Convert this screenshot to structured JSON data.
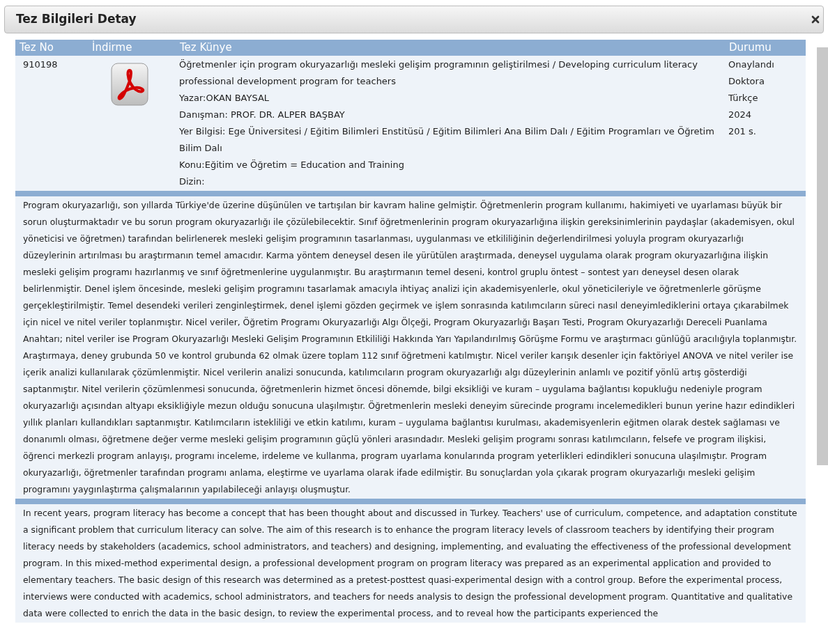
{
  "dialog": {
    "title": "Tez Bilgileri Detay"
  },
  "table": {
    "columns": [
      "Tez No",
      "İndirme",
      "Tez Künye",
      "Durumu"
    ],
    "thesis_no": "910198",
    "kunye": [
      "Öğretmenler için program okuryazarlığı mesleki gelişim programının geliştirilmesi / Developing curriculum literacy professional development program for teachers",
      "Yazar:OKAN BAYSAL",
      "Danışman: PROF. DR. ALPER BAŞBAY",
      "Yer Bilgisi: Ege Üniversitesi / Eğitim Bilimleri Enstitüsü / Eğitim Bilimleri Ana Bilim Dalı / Eğitim Programları ve Öğretim Bilim Dalı",
      "Konu:Eğitim ve Öğretim = Education and Training",
      "Dizin:"
    ],
    "durumu": [
      "Onaylandı",
      "Doktora",
      "Türkçe",
      "2024",
      "201 s."
    ]
  },
  "abstracts": [
    "Program okuryazarlığı, son yıllarda Türkiye'de üzerine düşünülen ve tartışılan bir kavram haline gelmiştir. Öğretmenlerin program kullanımı, hakimiyeti ve uyarlaması büyük bir sorun oluşturmaktadır ve bu sorun program okuryazarlığı ile çözülebilecektir. Sınıf öğretmenlerinin program okuryazarlığına ilişkin gereksinimlerinin paydaşlar (akademisyen, okul yöneticisi ve öğretmen) tarafından belirlenerek mesleki gelişim programının tasarlanması, uygulanması ve etkililiğinin değerlendirilmesi yoluyla program okuryazarlığı düzeylerinin artırılması bu araştırmanın temel amacıdır. Karma yöntem deneysel desen ile yürütülen araştırmada, deneysel uygulama olarak program okuryazarlığına ilişkin mesleki gelişim programı hazırlanmış ve sınıf öğretmenlerine uygulanmıştır. Bu araştırmanın temel deseni, kontrol gruplu öntest – sontest yarı deneysel desen olarak belirlenmiştir. Denel işlem öncesinde, mesleki gelişim programını tasarlamak amacıyla ihtiyaç analizi için akademisyenlerle, okul yöneticileriyle ve öğretmenlerle görüşme gerçekleştirilmiştir. Temel desendeki verileri zenginleştirmek, denel işlemi gözden geçirmek ve işlem sonrasında katılımcıların süreci nasıl deneyimlediklerini ortaya çıkarabilmek için nicel ve nitel veriler toplanmıştır. Nicel veriler, Öğretim Programı Okuryazarlığı Algı Ölçeği, Program Okuryazarlığı Başarı Testi, Program Okuryazarlığı Dereceli Puanlama Anahtarı; nitel veriler ise Program Okuryazarlığı Mesleki Gelişim Programının Etkililiği Hakkında Yarı Yapılandırılmış Görüşme Formu ve araştırmacı günlüğü aracılığıyla toplanmıştır. Araştırmaya, deney grubunda 50 ve kontrol grubunda 62 olmak üzere toplam 112 sınıf öğretmeni katılmıştır. Nicel veriler karışık desenler için faktöriyel ANOVA ve nitel veriler ise içerik analizi kullanılarak çözümlenmiştir. Nicel verilerin analizi sonucunda, katılımcıların program okuryazarlığı algı düzeylerinin anlamlı ve pozitif yönlü artış gösterdiği saptanmıştır. Nitel verilerin çözümlenmesi sonucunda, öğretmenlerin hizmet öncesi dönemde, bilgi eksikliği ve kuram – uygulama bağlantısı kopukluğu nedeniyle program okuryazarlığı açısından altyapı eksikliğiyle mezun olduğu sonucuna ulaşılmıştır. Öğretmenlerin mesleki deneyim sürecinde programı incelemedikleri bunun yerine hazır edindikleri yıllık planları kullandıkları saptanmıştır. Katılımcıların istekliliği ve etkin katılımı, kuram – uygulama bağlantısı kurulması, akademisyenlerin eğitmen olarak destek sağlaması ve donanımlı olması, öğretmene değer verme mesleki gelişim programının güçlü yönleri arasındadır. Mesleki gelişim programı sonrası katılımcıların, felsefe ve program ilişkisi, öğrenci merkezli program anlayışı, programı inceleme, irdeleme ve kullanma, program uyarlama konularında program yeterlikleri edindikleri sonucuna ulaşılmıştır. Program okuryazarlığı, öğretmenler tarafından programı anlama, eleştirme ve uyarlama olarak ifade edilmiştir. Bu sonuçlardan yola çıkarak program okuryazarlığı mesleki gelişim programını yaygınlaştırma çalışmalarının yapılabileceği anlayışı oluşmuştur.",
    "In recent years, program literacy has become a concept that has been thought about and discussed in Turkey. Teachers' use of curriculum, competence, and adaptation constitute a significant problem that curriculum literacy can solve. The aim of this research is to enhance the program literacy levels of classroom teachers by identifying their program literacy needs by stakeholders (academics, school administrators, and teachers) and designing, implementing, and evaluating the effectiveness of the professional development program. In this mixed-method experimental design, a professional development program on program literacy was prepared as an experimental application and provided to elementary teachers. The basic design of this research was determined as a pretest-posttest quasi-experimental design with a control group. Before the experimental process, interviews were conducted with academics, school administrators, and teachers for needs analysis to design the professional development program. Quantitative and qualitative data were collected to enrich the data in the basic design, to review the experimental process, and to reveal how the participants experienced the"
  ]
}
